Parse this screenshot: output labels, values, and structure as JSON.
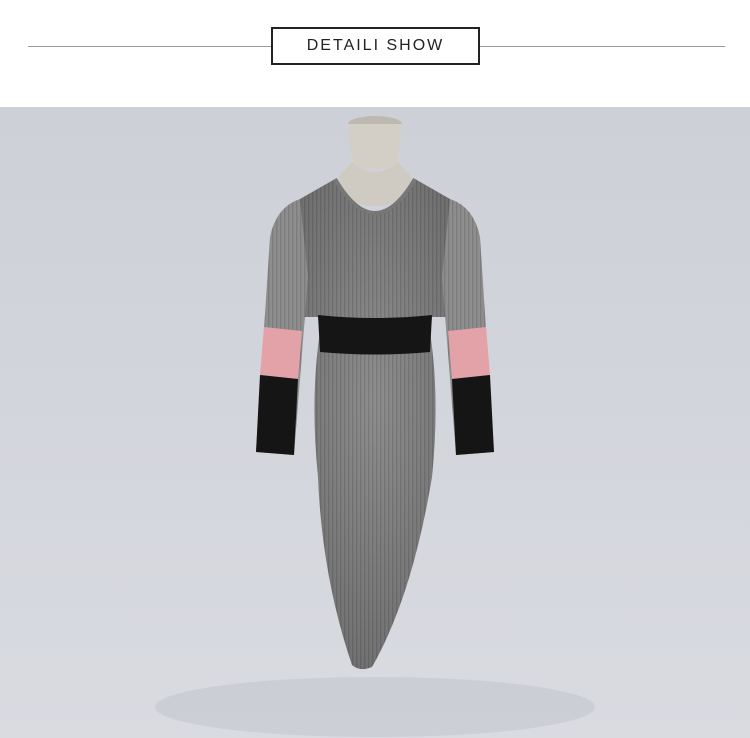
{
  "header": {
    "title": "DETAILI SHOW"
  },
  "photo": {
    "subject": "dress-on-mannequin",
    "colors": {
      "backdrop": "#cfd2d9",
      "dress": "#8a8a8a",
      "waist_band": "#151515",
      "cuff_pink": "#e3a1a8",
      "cuff_black": "#151515",
      "mannequin": "#cfcbc4"
    }
  }
}
